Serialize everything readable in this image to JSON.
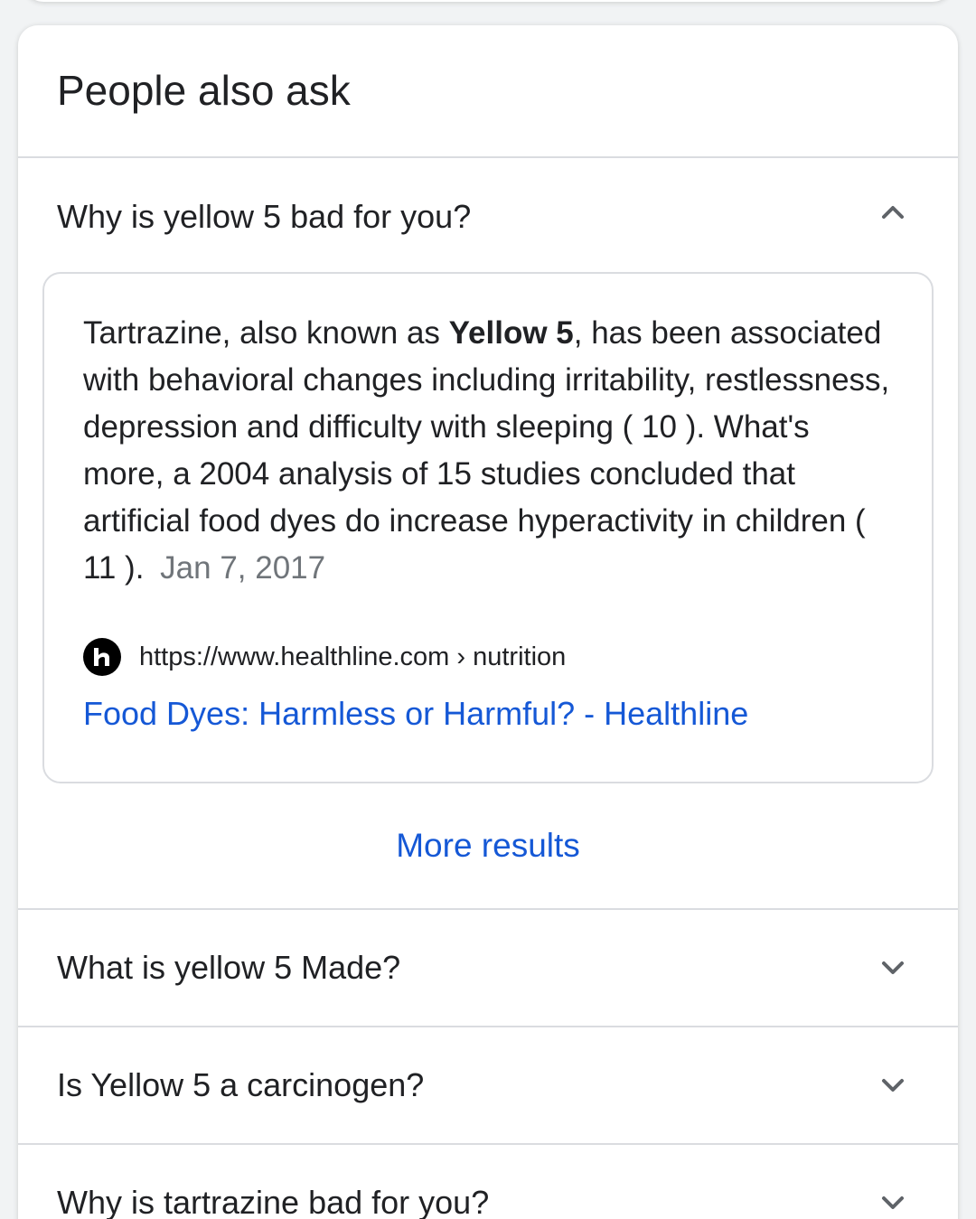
{
  "paa": {
    "title": "People also ask",
    "expanded": {
      "question": "Why is yellow 5 bad for you?",
      "answer_pre": "Tartrazine, also known as ",
      "answer_bold": "Yellow 5",
      "answer_post": ", has been associated with behavioral changes including irritability, restlessness, depression and difficulty with sleeping ( 10 ). What's more, a 2004 analysis of 15 studies concluded that artificial food dyes do increase hyperactivity in children ( 11 ).",
      "date": "Jan 7, 2017",
      "source_url": "https://www.healthline.com › nutrition",
      "result_title": "Food Dyes: Harmless or Harmful? - Healthline",
      "more_results": "More results"
    },
    "questions": [
      "What is yellow 5 Made?",
      "Is Yellow 5 a carcinogen?",
      "Why is tartrazine bad for you?"
    ],
    "icons": {
      "expanded_chevron": "chevron-up-icon",
      "collapsed_chevron": "chevron-down-icon",
      "favicon": "healthline-favicon-icon"
    },
    "colors": {
      "link": "#1558d6",
      "text": "#202124",
      "muted": "#70757a",
      "divider": "#dadce0"
    }
  }
}
